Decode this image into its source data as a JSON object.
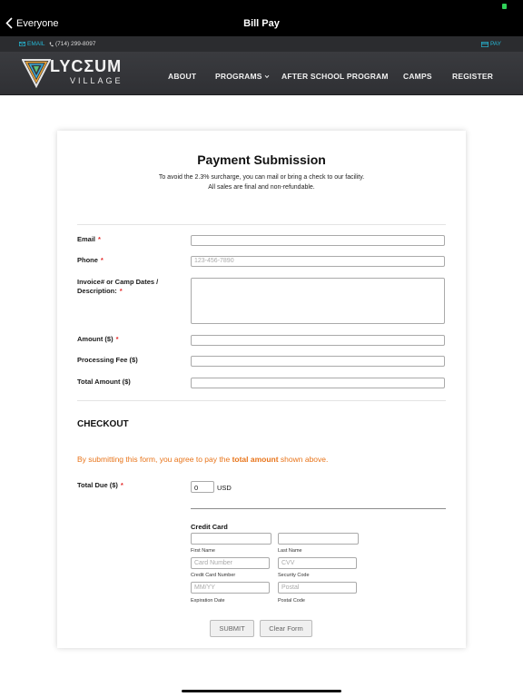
{
  "status_bar": {
    "back_label": "Everyone",
    "title": "Bill Pay"
  },
  "top_bar": {
    "email": "EMAIL",
    "phone": "(714) 299-8097",
    "pay": "PAY"
  },
  "brand": {
    "name": "LYCΣUM",
    "sub": "VILLAGE"
  },
  "nav": {
    "about": "ABOUT",
    "programs": "PROGRAMS",
    "after_school": "AFTER SCHOOL PROGRAM",
    "camps": "CAMPS",
    "register": "REGISTER"
  },
  "form": {
    "title": "Payment Submission",
    "subtitle_line1": "To avoid the 2.3% surcharge, you can mail or bring a check to our facility.",
    "subtitle_line2": "All sales are final and non-refundable.",
    "fields": {
      "email": {
        "label": "Email",
        "required": "*",
        "value": "",
        "placeholder": ""
      },
      "phone": {
        "label": "Phone",
        "required": "*",
        "placeholder": "123-456-7890"
      },
      "invoice": {
        "label_line1": "Invoice# or Camp Dates /",
        "label_line2": "Description:",
        "required": "*"
      },
      "amount": {
        "label": "Amount ($)",
        "required": "*"
      },
      "processing_fee": {
        "label": "Processing Fee ($)"
      },
      "total_amount": {
        "label": "Total Amount ($)"
      }
    },
    "checkout": {
      "heading": "CHECKOUT",
      "notice_before": "By submitting this form, you agree to pay the ",
      "notice_bold": "total amount",
      "notice_after": " shown above.",
      "total_due_label": "Total Due ($)",
      "total_due_required": "*",
      "total_due_value": "0",
      "currency": "USD"
    },
    "credit_card": {
      "heading": "Credit Card",
      "first_name_label": "First Name",
      "last_name_label": "Last Name",
      "card_number_placeholder": "Card Number",
      "card_number_label": "Credit Card Number",
      "cvv_placeholder": "CVV",
      "cvv_label": "Security Code",
      "expiry_placeholder": "MM/YY",
      "expiry_label": "Expiration Date",
      "postal_placeholder": "Postal",
      "postal_label": "Postal Code"
    },
    "buttons": {
      "submit": "SUBMIT",
      "clear": "Clear Form"
    }
  },
  "colors": {
    "accent": "#26b8d6",
    "notice": "#e8741a",
    "required": "#e42a2a",
    "nav_bg": "#333438"
  }
}
